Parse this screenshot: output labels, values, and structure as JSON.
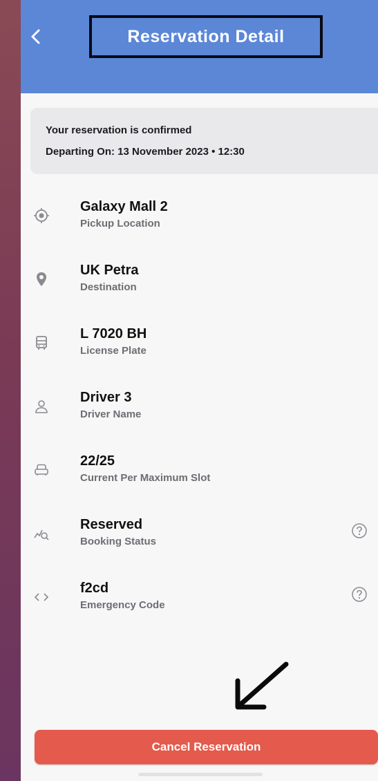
{
  "header": {
    "back_icon": "chevron-left-icon",
    "title": "Reservation Detail",
    "colors": {
      "header_bg": "#5b87d6",
      "title": "#ffffff"
    }
  },
  "banner": {
    "line1": "Your reservation is confirmed",
    "line2": "Departing On: 13 November 2023 • 12:30"
  },
  "details": [
    {
      "icon": "target-icon",
      "title": "Galaxy Mall 2",
      "subtitle": "Pickup Location"
    },
    {
      "icon": "map-pin-icon",
      "title": "UK Petra",
      "subtitle": "Destination"
    },
    {
      "icon": "bus-icon",
      "title": "L 7020 BH",
      "subtitle": "License Plate"
    },
    {
      "icon": "person-icon",
      "title": "Driver 3",
      "subtitle": "Driver Name"
    },
    {
      "icon": "seat-icon",
      "title": "22/25",
      "subtitle": "Current Per Maximum Slot"
    },
    {
      "icon": "status-search-icon",
      "title": "Reserved",
      "subtitle": "Booking Status",
      "help_icon": "question-circle-icon"
    },
    {
      "icon": "code-icon",
      "title": "f2cd",
      "subtitle": "Emergency Code",
      "help_icon": "question-circle-icon"
    }
  ],
  "actions": {
    "cancel_label": "Cancel Reservation",
    "cancel_color": "#e45a4c"
  },
  "annotation": {
    "icon": "arrow-down-left-icon"
  }
}
